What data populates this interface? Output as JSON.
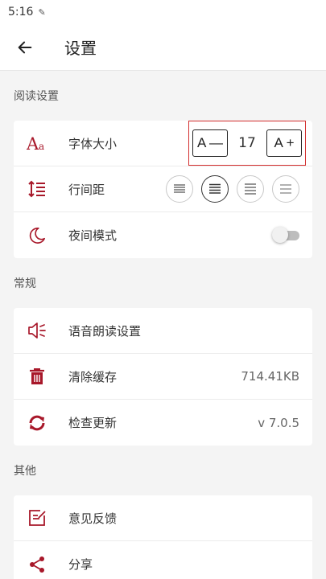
{
  "status_bar": {
    "time": "5:16",
    "pen_glyph": "✎"
  },
  "app_bar": {
    "back_icon": "arrow-left-icon",
    "title": "设置"
  },
  "sections": {
    "reading": {
      "header": "阅读设置",
      "font_size": {
        "label": "字体大小",
        "decrease": "A —",
        "value": "17",
        "increase": "A +"
      },
      "line_spacing": {
        "label": "行间距"
      },
      "night_mode": {
        "label": "夜间模式",
        "enabled": false
      }
    },
    "general": {
      "header": "常规",
      "tts": {
        "label": "语音朗读设置"
      },
      "clear_cache": {
        "label": "清除缓存",
        "value": "714.41KB"
      },
      "check_update": {
        "label": "检查更新",
        "value": "v 7.0.5"
      }
    },
    "other": {
      "header": "其他",
      "feedback": {
        "label": "意见反馈"
      },
      "share": {
        "label": "分享"
      }
    }
  },
  "colors": {
    "accent": "#a8182a",
    "highlight_border": "#d32f2f"
  }
}
